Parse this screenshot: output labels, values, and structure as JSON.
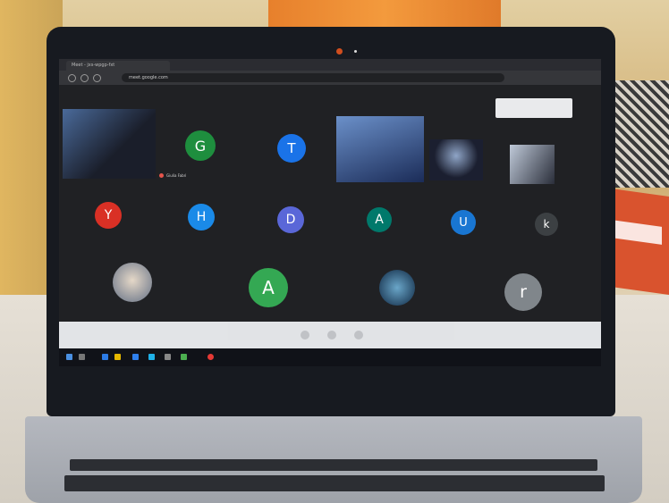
{
  "browser": {
    "tab_title": "Meet - jxs-wpgp-fxt",
    "url": "meet.google.com"
  },
  "meet": {
    "pinned_label": "",
    "controls": {
      "a": "",
      "b": "",
      "c": ""
    },
    "tiles": [
      {
        "kind": "video",
        "name": ""
      },
      {
        "kind": "letter",
        "letter": "G",
        "color": "#1e8e3e",
        "name": "Giulia Fabri"
      },
      {
        "kind": "letter",
        "letter": "T",
        "color": "#1a73e8",
        "name": ""
      },
      {
        "kind": "video",
        "name": ""
      },
      {
        "kind": "video",
        "name": ""
      },
      {
        "kind": "video",
        "name": ""
      },
      {
        "kind": "letter",
        "letter": "Y",
        "color": "#d93025",
        "name": ""
      },
      {
        "kind": "letter",
        "letter": "H",
        "color": "#1a8ae8",
        "name": ""
      },
      {
        "kind": "letter",
        "letter": "D",
        "color": "#5a67d8",
        "name": ""
      },
      {
        "kind": "letter",
        "letter": "A",
        "color": "#00796b",
        "name": ""
      },
      {
        "kind": "letter",
        "letter": "U",
        "color": "#1976d2",
        "name": ""
      },
      {
        "kind": "letter",
        "letter": "k",
        "color": "#3c4043",
        "name": ""
      },
      {
        "kind": "photo",
        "name": ""
      },
      {
        "kind": "letter",
        "letter": "A",
        "color": "#34a853",
        "name": ""
      },
      {
        "kind": "photo",
        "name": ""
      },
      {
        "kind": "letter",
        "letter": "r",
        "color": "#80868b",
        "name": ""
      }
    ],
    "bottom_text": ""
  },
  "taskbar": {
    "time": "",
    "date": ""
  },
  "colors": {
    "bezel": "#171a20",
    "screen": "#202124",
    "curtain": "#f39a3d"
  }
}
